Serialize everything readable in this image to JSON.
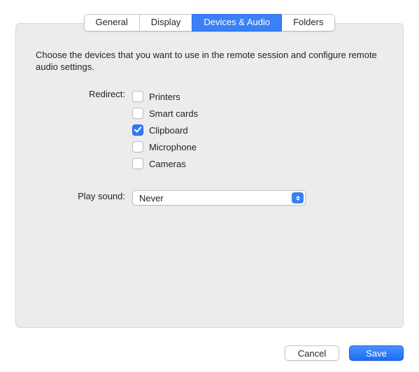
{
  "tabs": {
    "general": "General",
    "display": "Display",
    "devices_audio": "Devices & Audio",
    "folders": "Folders",
    "active": "devices_audio"
  },
  "panel": {
    "description": "Choose the devices that you want to use in the remote session and configure remote audio settings.",
    "redirect_label": "Redirect:",
    "redirect_options": {
      "printers": {
        "label": "Printers",
        "checked": false
      },
      "smart_cards": {
        "label": "Smart cards",
        "checked": false
      },
      "clipboard": {
        "label": "Clipboard",
        "checked": true
      },
      "microphone": {
        "label": "Microphone",
        "checked": false
      },
      "cameras": {
        "label": "Cameras",
        "checked": false
      }
    },
    "play_sound_label": "Play sound:",
    "play_sound_value": "Never"
  },
  "buttons": {
    "cancel": "Cancel",
    "save": "Save"
  }
}
